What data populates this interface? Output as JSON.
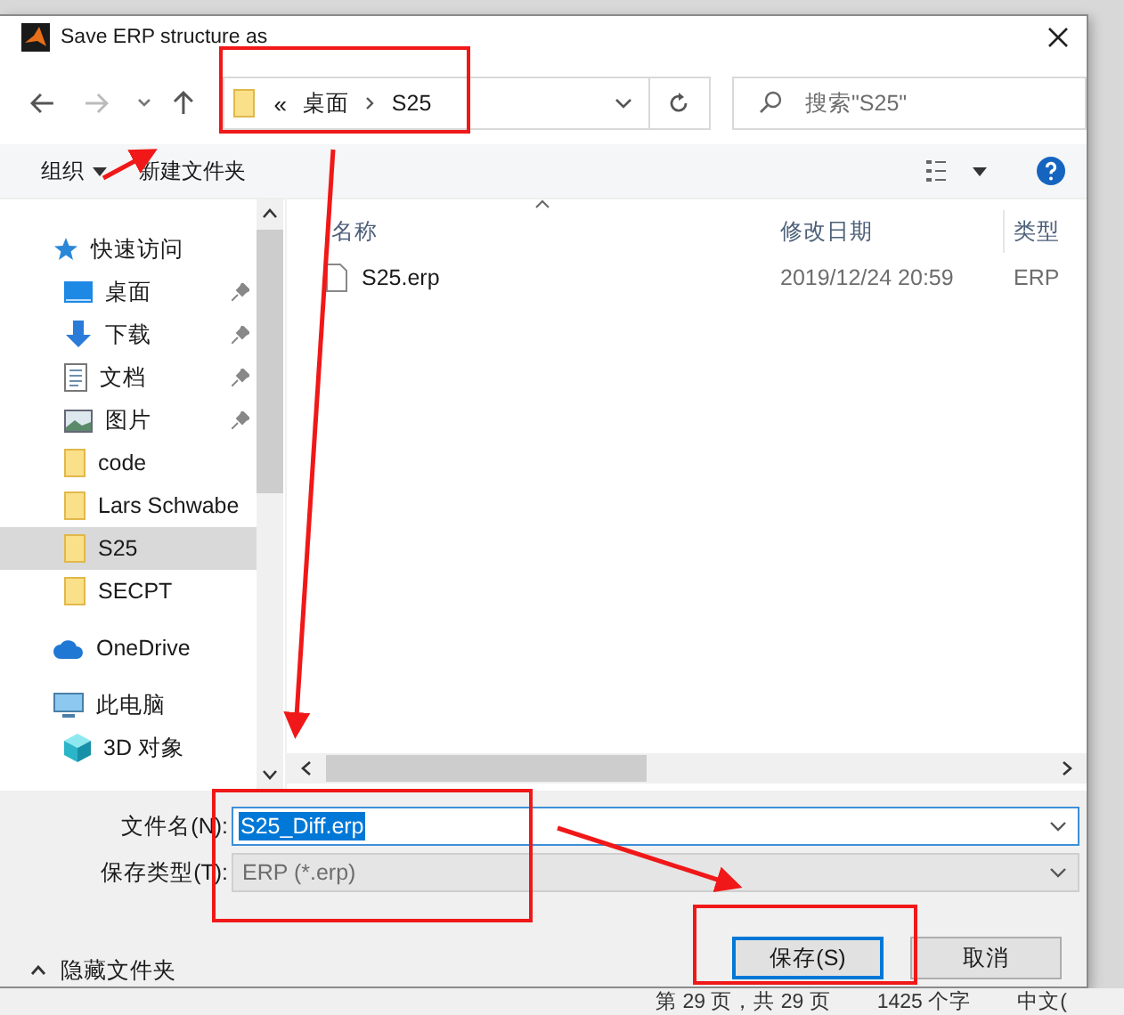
{
  "window": {
    "title": "Save ERP structure as"
  },
  "address": {
    "overflow": "«",
    "crumbs": [
      "桌面",
      "S25"
    ]
  },
  "search": {
    "placeholder": "搜索\"S25\""
  },
  "toolbar": {
    "organize": "组织",
    "new_folder": "新建文件夹"
  },
  "sidebar": {
    "items": [
      {
        "label": "快速访问",
        "kind": "star",
        "selected": false,
        "children": [
          {
            "label": "桌面",
            "kind": "desktop",
            "pinned": true,
            "selected": false
          },
          {
            "label": "下载",
            "kind": "download",
            "pinned": true,
            "selected": false
          },
          {
            "label": "文档",
            "kind": "document",
            "pinned": true,
            "selected": false
          },
          {
            "label": "图片",
            "kind": "image",
            "pinned": true,
            "selected": false
          },
          {
            "label": "code",
            "kind": "folder",
            "pinned": false,
            "selected": false
          },
          {
            "label": "Lars Schwabe",
            "kind": "folder",
            "pinned": false,
            "selected": false
          },
          {
            "label": "S25",
            "kind": "folder",
            "pinned": false,
            "selected": true
          },
          {
            "label": "SECPT",
            "kind": "folder",
            "pinned": false,
            "selected": false
          }
        ]
      },
      {
        "label": "OneDrive",
        "kind": "cloud",
        "selected": false
      },
      {
        "label": "此电脑",
        "kind": "computer",
        "selected": false,
        "children": [
          {
            "label": "3D 对象",
            "kind": "cube",
            "pinned": false,
            "selected": false
          }
        ]
      }
    ]
  },
  "table": {
    "columns": [
      "名称",
      "修改日期",
      "类型"
    ],
    "rows": [
      {
        "name": "S25.erp",
        "modified": "2019/12/24 20:59",
        "type": "ERP"
      }
    ]
  },
  "filename": {
    "label": "文件名(N):",
    "value": "S25_Diff.erp"
  },
  "filetype": {
    "label": "保存类型(T):",
    "value": "ERP (*.erp)"
  },
  "hide_folders": "隐藏文件夹",
  "buttons": [
    {
      "label": "保存(S)",
      "selected": true
    },
    {
      "label": "取消",
      "selected": false
    }
  ],
  "status_bar": [
    "第 29 页，共 29 页",
    "1425 个字",
    "中文("
  ]
}
